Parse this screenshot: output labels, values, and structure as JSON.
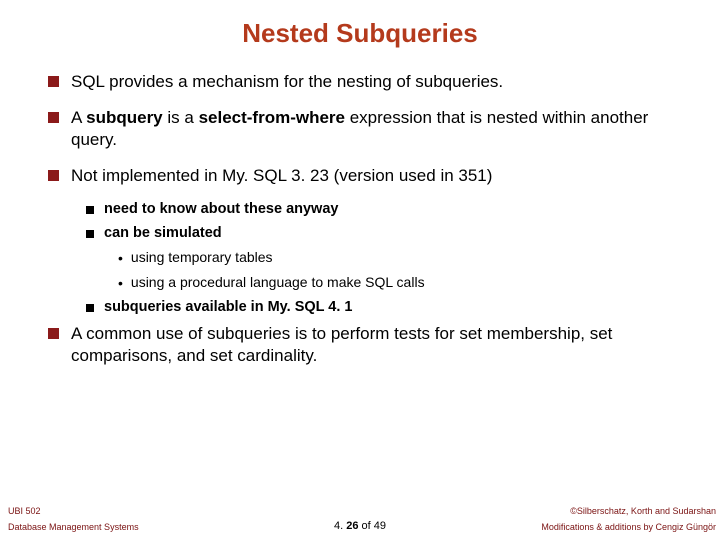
{
  "title": "Nested Subqueries",
  "bullets": {
    "b1_1": "SQL provides a mechanism for the nesting of subqueries.",
    "b1_2_pre": "A ",
    "b1_2_bold1": "subquery",
    "b1_2_mid": " is a ",
    "b1_2_bold2": "select-from-where",
    "b1_2_post": " expression that is nested within another query.",
    "b1_3": "Not implemented in My. SQL 3. 23 (version used in 351)",
    "b2_1": "need to know about these anyway",
    "b2_2": "can be simulated",
    "b3_1": "using temporary tables",
    "b3_2": "using a procedural language to make SQL calls",
    "b2_3": "subqueries available in My. SQL 4. 1",
    "b1_4": "A common use of subqueries is to perform tests for set membership, set comparisons, and set cardinality."
  },
  "footer": {
    "course": "UBI 502",
    "copyright": "©Silberschatz, Korth and Sudarshan",
    "subtitle": "Database Management Systems",
    "page_prefix": "4. ",
    "page_num": "26",
    "page_suffix": " of 49",
    "mods": "Modifications & additions by Cengiz Güngör"
  }
}
